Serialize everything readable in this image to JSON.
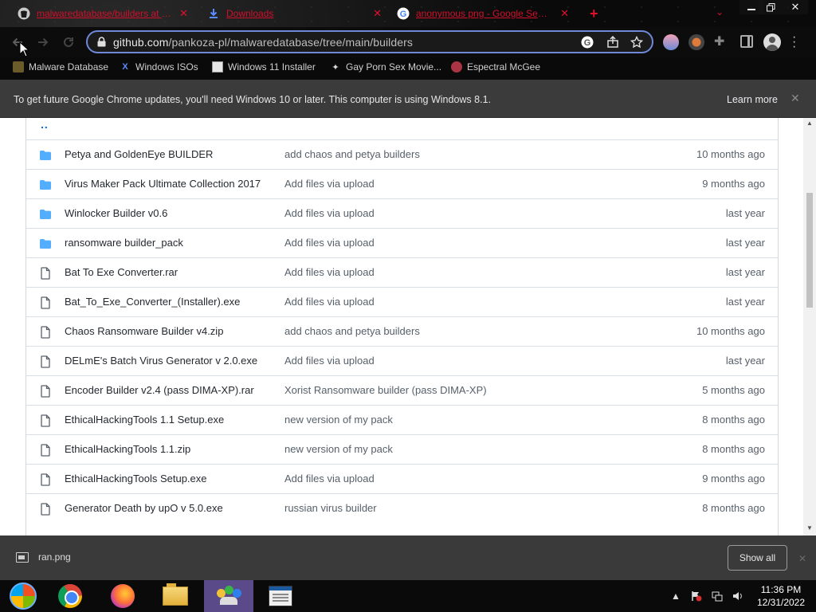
{
  "tabs": [
    {
      "title": "malwaredatabase/builders at mai",
      "icon": "github-icon"
    },
    {
      "title": "Downloads",
      "icon": "download-icon"
    },
    {
      "title": "anonymous png - Google Search",
      "icon": "google-icon"
    }
  ],
  "toolbar": {
    "url_domain": "github.com",
    "url_path": "/pankoza-pl/malwaredatabase/tree/main/builders"
  },
  "bookmarks": [
    {
      "label": "Malware Database",
      "icon": "bookmark-favicon"
    },
    {
      "label": "Windows ISOs",
      "icon": "x-icon"
    },
    {
      "label": "Windows 11 Installer",
      "icon": "page-icon"
    },
    {
      "label": "Gay Porn Sex Movie...",
      "icon": "site-icon"
    },
    {
      "label": "Espectral McGee",
      "icon": "avatar-icon"
    }
  ],
  "infobar": {
    "message": "To get future Google Chrome updates, you'll need Windows 10 or later. This computer is using Windows 8.1.",
    "learn_more": "Learn more",
    "close": "✕"
  },
  "files": {
    "parent": "..",
    "rows": [
      {
        "type": "folder",
        "name": "Petya and GoldenEye BUILDER",
        "message": "add chaos and petya builders",
        "date": "10 months ago"
      },
      {
        "type": "folder",
        "name": "Virus Maker Pack Ultimate Collection 2017",
        "message": "Add files via upload",
        "date": "9 months ago"
      },
      {
        "type": "folder",
        "name": "Winlocker Builder v0.6",
        "message": "Add files via upload",
        "date": "last year"
      },
      {
        "type": "folder",
        "name": "ransomware builder_pack",
        "message": "Add files via upload",
        "date": "last year"
      },
      {
        "type": "file",
        "name": "Bat To Exe Converter.rar",
        "message": "Add files via upload",
        "date": "last year"
      },
      {
        "type": "file",
        "name": "Bat_To_Exe_Converter_(Installer).exe",
        "message": "Add files via upload",
        "date": "last year"
      },
      {
        "type": "file",
        "name": "Chaos Ransomware Builder v4.zip",
        "message": "add chaos and petya builders",
        "date": "10 months ago"
      },
      {
        "type": "file",
        "name": "DELmE's Batch Virus Generator v 2.0.exe",
        "message": "Add files via upload",
        "date": "last year"
      },
      {
        "type": "file",
        "name": "Encoder Builder v2.4 (pass DIMA-XP).rar",
        "message": "Xorist Ransomware builder (pass DIMA-XP)",
        "date": "5 months ago"
      },
      {
        "type": "file",
        "name": "EthicalHackingTools 1.1 Setup.exe",
        "message": "new version of my pack",
        "date": "8 months ago"
      },
      {
        "type": "file",
        "name": "EthicalHackingTools 1.1.zip",
        "message": "new version of my pack",
        "date": "8 months ago"
      },
      {
        "type": "file",
        "name": "EthicalHackingTools Setup.exe",
        "message": "Add files via upload",
        "date": "9 months ago"
      },
      {
        "type": "file",
        "name": "Generator Death by upO v 5.0.exe",
        "message": "russian virus builder",
        "date": "8 months ago"
      }
    ]
  },
  "downloads": {
    "filename": "ran.png",
    "show_all": "Show all"
  },
  "taskbar": {
    "time": "11:36 PM",
    "date": "12/31/2022"
  },
  "colors": {
    "tab_text": "#d0102a",
    "folder": "#54aeff",
    "link": "#0969da",
    "omnibox_border": "#6f88d8"
  }
}
